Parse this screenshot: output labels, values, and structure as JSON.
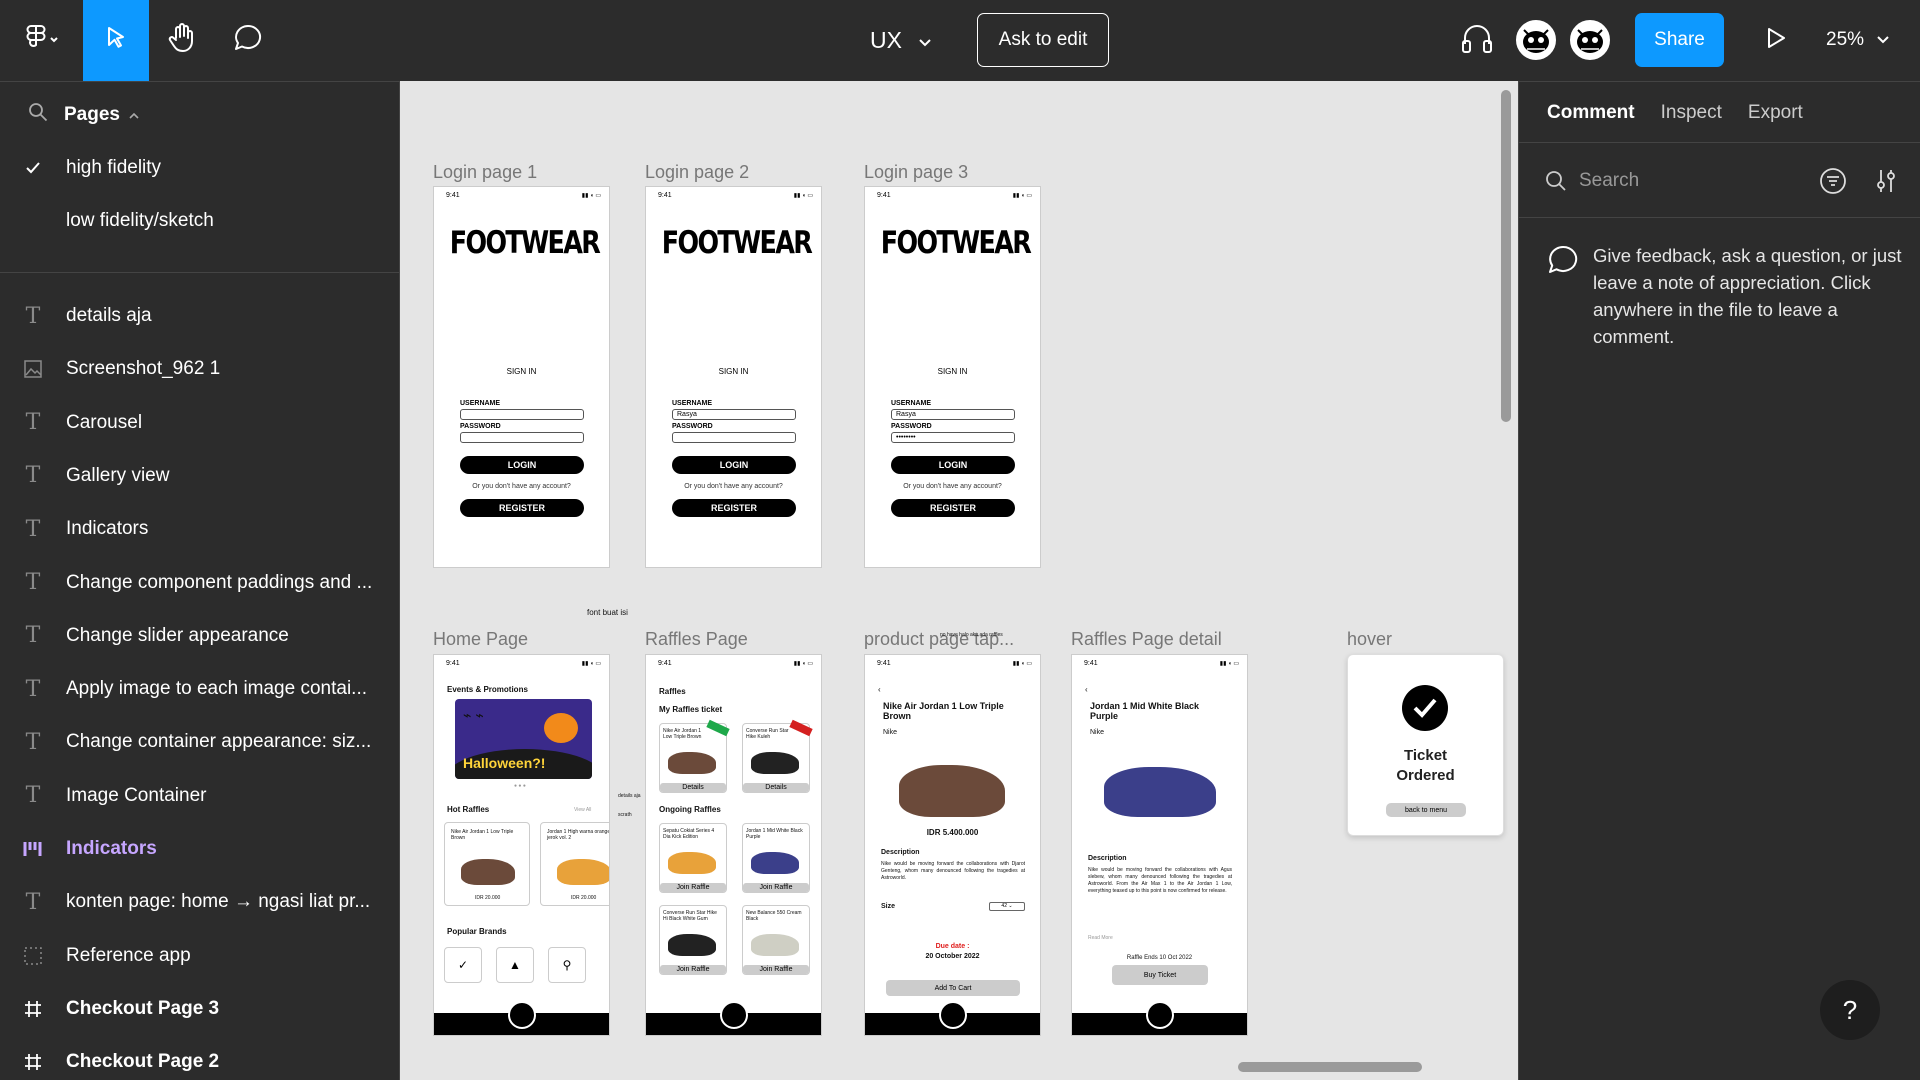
{
  "toolbar": {
    "file_name": "UX",
    "ask_to_edit": "Ask to edit",
    "share": "Share",
    "zoom": "25%"
  },
  "pages": {
    "title": "Pages",
    "items": [
      {
        "label": "high fidelity",
        "selected": true
      },
      {
        "label": "low fidelity/sketch",
        "selected": false
      }
    ]
  },
  "layers": [
    {
      "label": "details aja",
      "icon": "text-icon"
    },
    {
      "label": "Screenshot_962 1",
      "icon": "image-icon"
    },
    {
      "label": "Carousel",
      "icon": "text-icon"
    },
    {
      "label": "Gallery view",
      "icon": "text-icon"
    },
    {
      "label": "Indicators",
      "icon": "text-icon"
    },
    {
      "label": "Change component paddings and ...",
      "icon": "text-icon"
    },
    {
      "label": "Change slider appearance",
      "icon": "text-icon"
    },
    {
      "label": "Apply image to each image contai...",
      "icon": "text-icon"
    },
    {
      "label": "Change container appearance: siz...",
      "icon": "text-icon"
    },
    {
      "label": "Image Container",
      "icon": "text-icon"
    },
    {
      "label": "Indicators",
      "icon": "component-icon"
    },
    {
      "label": "konten page: home → ngasi liat pr...",
      "icon": "text-icon"
    },
    {
      "label": "Reference app",
      "icon": "section-icon"
    },
    {
      "label": "Checkout Page 3",
      "icon": "frame-icon"
    },
    {
      "label": "Checkout Page 2",
      "icon": "frame-icon"
    }
  ],
  "canvas": {
    "frame_labels": [
      "Login page 1",
      "Login page 2",
      "Login page 3",
      "Home Page",
      "Raffles Page",
      "product page tap...",
      "Raffles Page detail",
      "hover"
    ],
    "login": {
      "time": "9:41",
      "logo": "FOOTWEAR",
      "sign_in": "SIGN IN",
      "username_label": "USERNAME",
      "password_label": "PASSWORD",
      "username_value": "Rasya",
      "password_value": "••••••••",
      "login_btn": "LOGIN",
      "no_account": "Or you don't have any account?",
      "register_btn": "REGISTER"
    },
    "floating_note": "font buat isi",
    "home": {
      "events": "Events & Promotions",
      "banner": "Halloween?!",
      "hot_raffles": "Hot Raffles",
      "view_all": "View All",
      "item1": "Nike Air Jordan 1 Low Triple Brown",
      "item2": "Jordan 1 High warna orange jerok vol. 2",
      "price1": "IDR 20.000",
      "price2": "IDR 20.000",
      "popular_brands": "Popular Brands"
    },
    "raffles": {
      "title": "Raffles",
      "my_tickets": "My Raffles ticket",
      "t1": "Nike Air Jordan 1 Low Triple Brown",
      "t2": "Converse Run Star Hike Kuleh",
      "details": "Details",
      "ongoing": "Ongoing Raffles",
      "o1": "Sepatu Cokiat Series 4 Dia Kick Edition",
      "o2": "Jordan 1 Mid White Black Purple",
      "o3": "Converse Run Star Hike Hi Black White Gum",
      "o4": "New Balance 550 Cream Black",
      "join": "Join Raffle",
      "side_note": "details aja",
      "side_note2": "scrath"
    },
    "product": {
      "name": "Nike Air Jordan 1 Low Triple Brown",
      "brand": "Nike",
      "price": "IDR 5.400.000",
      "description_h": "Description",
      "description": "Nike would be moving forward the collaborations with Djarot Genteng, whom many denounced following the tragedies at Astroworld.",
      "size": "Size",
      "size_val": "42",
      "due": "Due date :",
      "due_date": "20 October 2022",
      "add_cart": "Add To Cart",
      "overlay_note": "no have halo aku ada raffles"
    },
    "raffle_detail": {
      "name": "Jordan 1 Mid White Black Purple",
      "brand": "Nike",
      "description_h": "Description",
      "description": "Nike would be moving forward the collaborations with Agus slebew, whom many denounced following the tragedies at Astroworld. From the Air Max 1 to the Air Jordan 1 Low, everything teased up to this point is now confirmed for release.",
      "read_more": "Read More",
      "ends": "Raffle Ends 10 Oct 2022",
      "buy": "Buy Ticket"
    },
    "hover": {
      "title": "Ticket Ordered",
      "back": "back to menu"
    }
  },
  "right_panel": {
    "tabs": [
      "Comment",
      "Inspect",
      "Export"
    ],
    "search_placeholder": "Search",
    "hint": "Give feedback, ask a question, or just leave a note of appreciation. Click anywhere in the file to leave a comment."
  },
  "help": "?"
}
